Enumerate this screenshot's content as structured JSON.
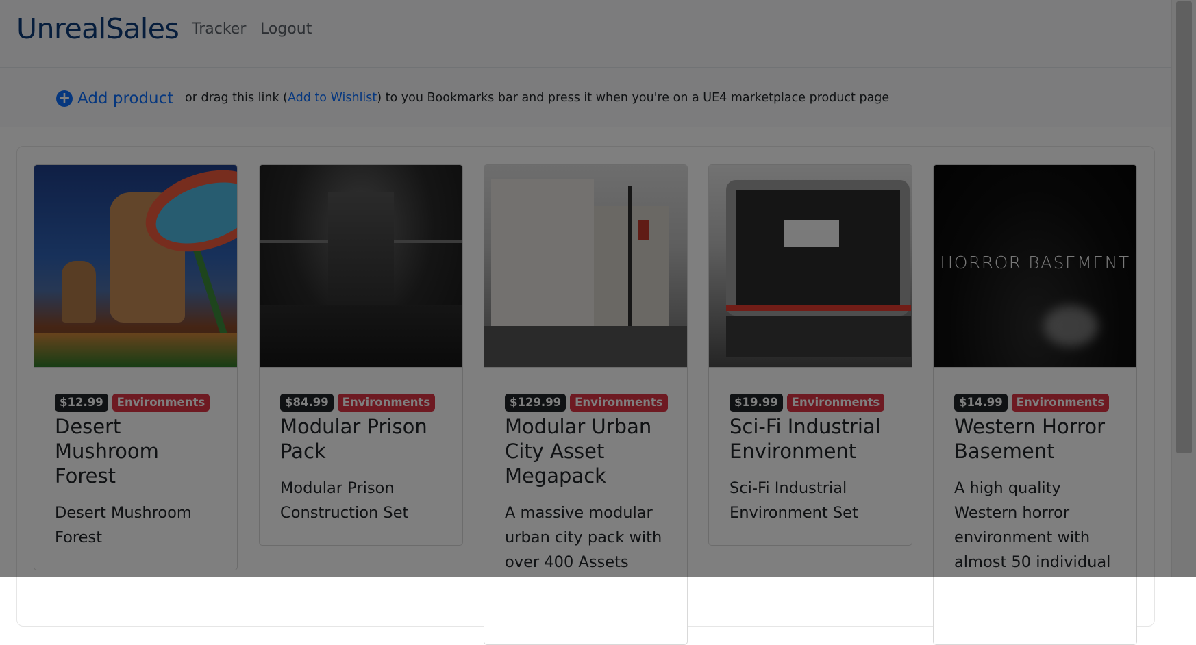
{
  "navbar": {
    "brand": "UnrealSales",
    "links": [
      "Tracker",
      "Logout"
    ]
  },
  "add_bar": {
    "add_label": "Add product",
    "hint_prefix": "or drag this link (",
    "hint_link": "Add to Wishlist",
    "hint_suffix": ") to you Bookmarks bar and press it when you're on a UE4 marketplace product page"
  },
  "products": [
    {
      "price": "$12.99",
      "category": "Environments",
      "title": "Desert Mushroom Forest",
      "description": "Desert Mushroom Forest"
    },
    {
      "price": "$84.99",
      "category": "Environments",
      "title": "Modular Prison Pack",
      "description": "Modular Prison Construction Set"
    },
    {
      "price": "$129.99",
      "category": "Environments",
      "title": "Modular Urban City Asset Megapack",
      "description": "A massive modular urban city pack with over 400 Assets"
    },
    {
      "price": "$19.99",
      "category": "Environments",
      "title": "Sci-Fi Industrial Environment",
      "description": "Sci-Fi Industrial Environment Set"
    },
    {
      "price": "$14.99",
      "category": "Environments",
      "title": "Western Horror Basement",
      "description": "A high quality Western horror environment with almost 50 individual",
      "thumbnail_text": "HORROR BASEMENT"
    }
  ],
  "colors": {
    "brand": "#0d3b78",
    "link": "#0d6efd",
    "price_badge": "#212529",
    "category_badge": "#dc3545",
    "overlay": "rgba(0,0,0,0.5)"
  },
  "icons": {
    "add": "plus-circle-icon"
  }
}
